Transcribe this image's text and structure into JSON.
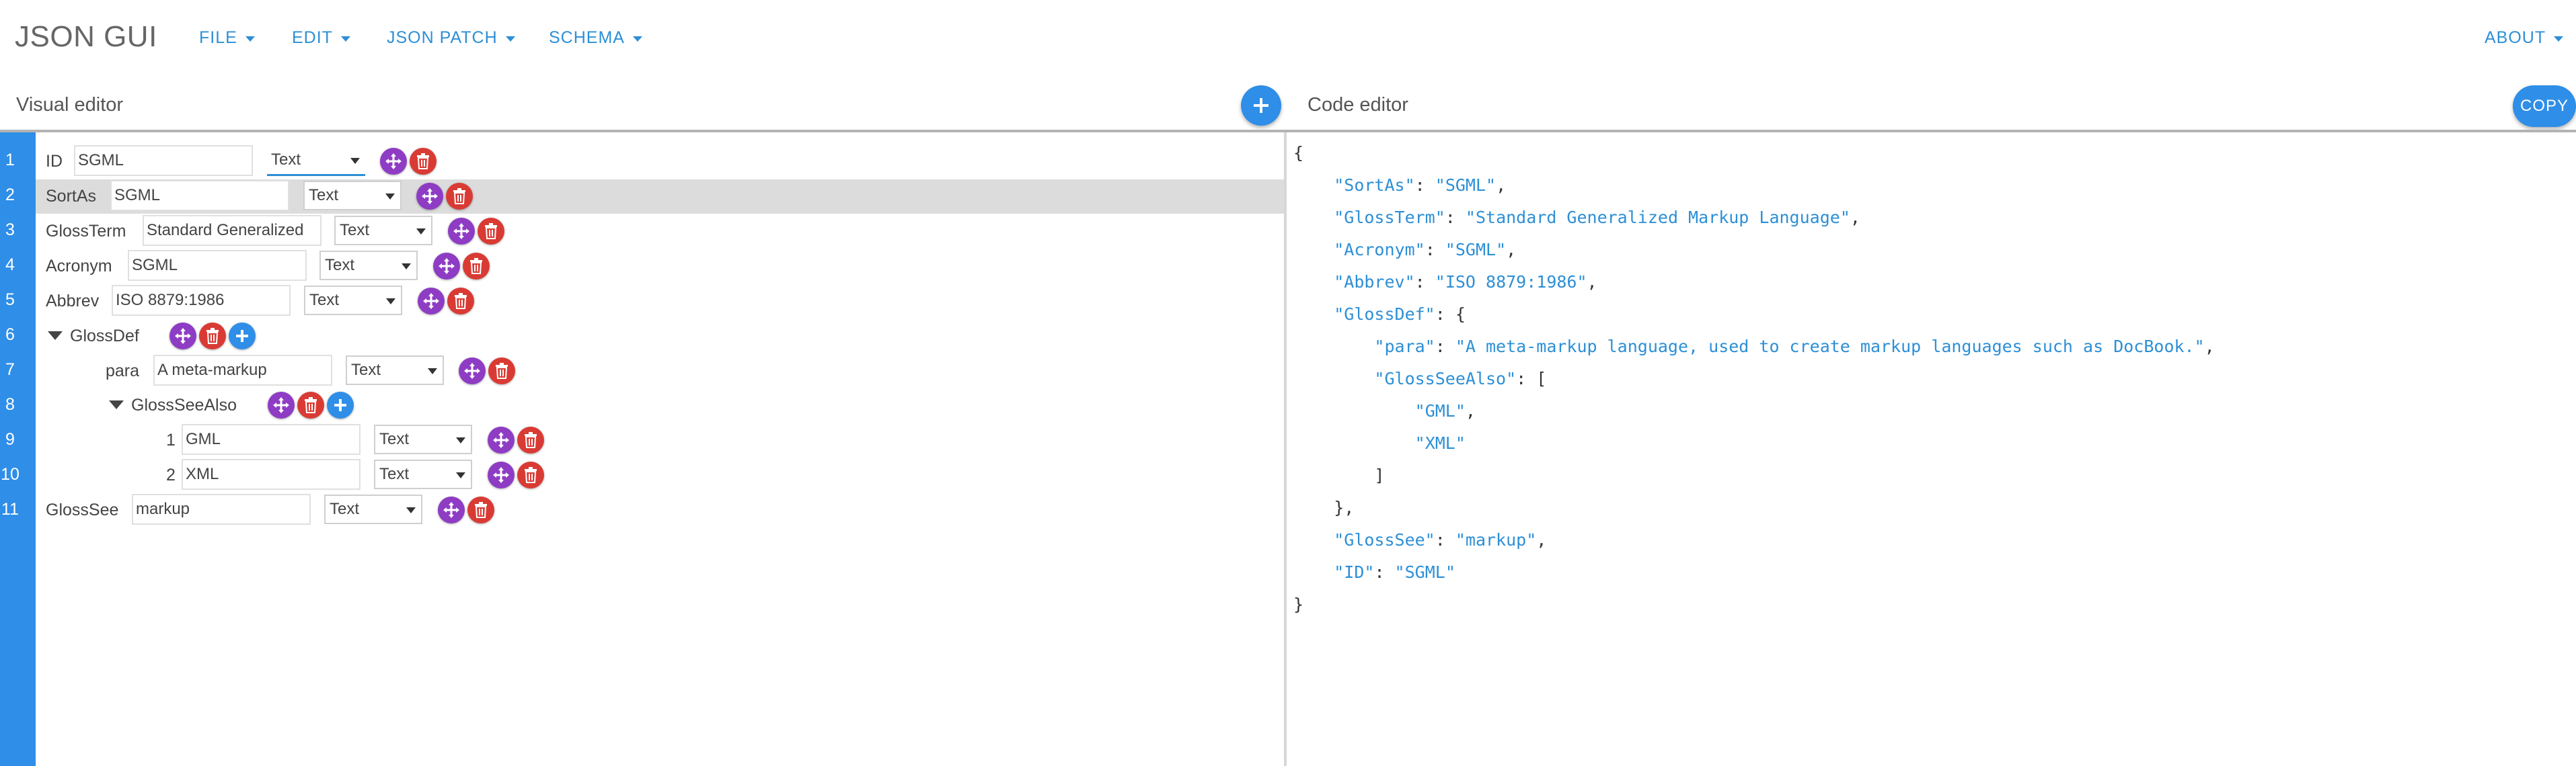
{
  "app": {
    "title": "JSON GUI"
  },
  "nav": {
    "menus": [
      "FILE",
      "EDIT",
      "JSON PATCH",
      "SCHEMA"
    ],
    "right_menu": "ABOUT"
  },
  "panels": {
    "visual_title": "Visual editor",
    "code_title": "Code editor",
    "copy_label": "COPY"
  },
  "colors": {
    "accent": "#2f8ee7",
    "move": "#8e3cc4",
    "delete": "#d93b34",
    "highlight": "#dcdcdc"
  },
  "visual_editor": {
    "line_numbers": [
      "1",
      "2",
      "3",
      "4",
      "5",
      "6",
      "7",
      "8",
      "9",
      "10",
      "11"
    ],
    "rows": [
      {
        "key": "ID",
        "value": "SGML",
        "type": "Text"
      },
      {
        "key": "SortAs",
        "value": "SGML",
        "type": "Text"
      },
      {
        "key": "GlossTerm",
        "value": "Standard Generalized",
        "type": "Text"
      },
      {
        "key": "Acronym",
        "value": "SGML",
        "type": "Text"
      },
      {
        "key": "Abbrev",
        "value": "ISO 8879:1986",
        "type": "Text"
      },
      {
        "key": "GlossDef"
      },
      {
        "key": "para",
        "value": "A meta-markup",
        "type": "Text"
      },
      {
        "key": "GlossSeeAlso"
      },
      {
        "key": "1",
        "value": "GML",
        "type": "Text"
      },
      {
        "key": "2",
        "value": "XML",
        "type": "Text"
      },
      {
        "key": "GlossSee",
        "value": "markup",
        "type": "Text"
      }
    ]
  },
  "code_editor": {
    "json": {
      "SortAs": "SGML",
      "GlossTerm": "Standard Generalized Markup Language",
      "Acronym": "SGML",
      "Abbrev": "ISO 8879:1986",
      "GlossDef": {
        "para": "A meta-markup language, used to create markup languages such as DocBook.",
        "GlossSeeAlso": [
          "GML",
          "XML"
        ]
      },
      "GlossSee": "markup",
      "ID": "SGML"
    }
  }
}
